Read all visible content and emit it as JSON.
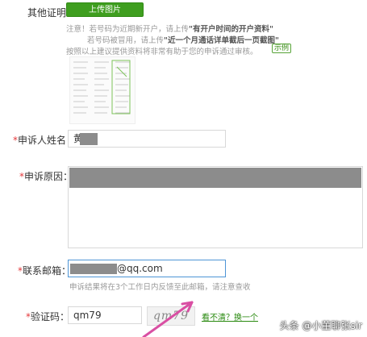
{
  "other_proof": {
    "label": "其他证明：",
    "upload_button": "上传图片"
  },
  "notes": {
    "line1_prefix": "注意！若号码为近期新开户，请上传",
    "line1_emph": "\"有开户时间的开户资料\"",
    "line2_prefix": "若号码被冒用，请上传",
    "line2_emph": "\"近一个月通话详单截后一页截图\"",
    "line3": "按照以上建议提供资料将非常有助于您的申诉通过审核。",
    "example_label": "示例"
  },
  "applicant": {
    "label": "申诉人姓名：",
    "value": "黄"
  },
  "reason": {
    "label": "申诉原因："
  },
  "email": {
    "label": "联系邮箱：",
    "value_suffix": "@qq.com",
    "hint": "申诉结果将在3个工作日内反馈至此邮箱，请注意查收"
  },
  "captcha": {
    "label": "验证码：",
    "value": "qm79",
    "image_text": "qm79",
    "refresh_link": "看不清？换一个"
  },
  "watermark": "头条 @小董聊张sir",
  "colors": {
    "primary_green": "#3f9e1f",
    "required_red": "#e4393c",
    "annotation_pink": "#d94fa3",
    "redaction_gray": "#8c8c8c"
  }
}
